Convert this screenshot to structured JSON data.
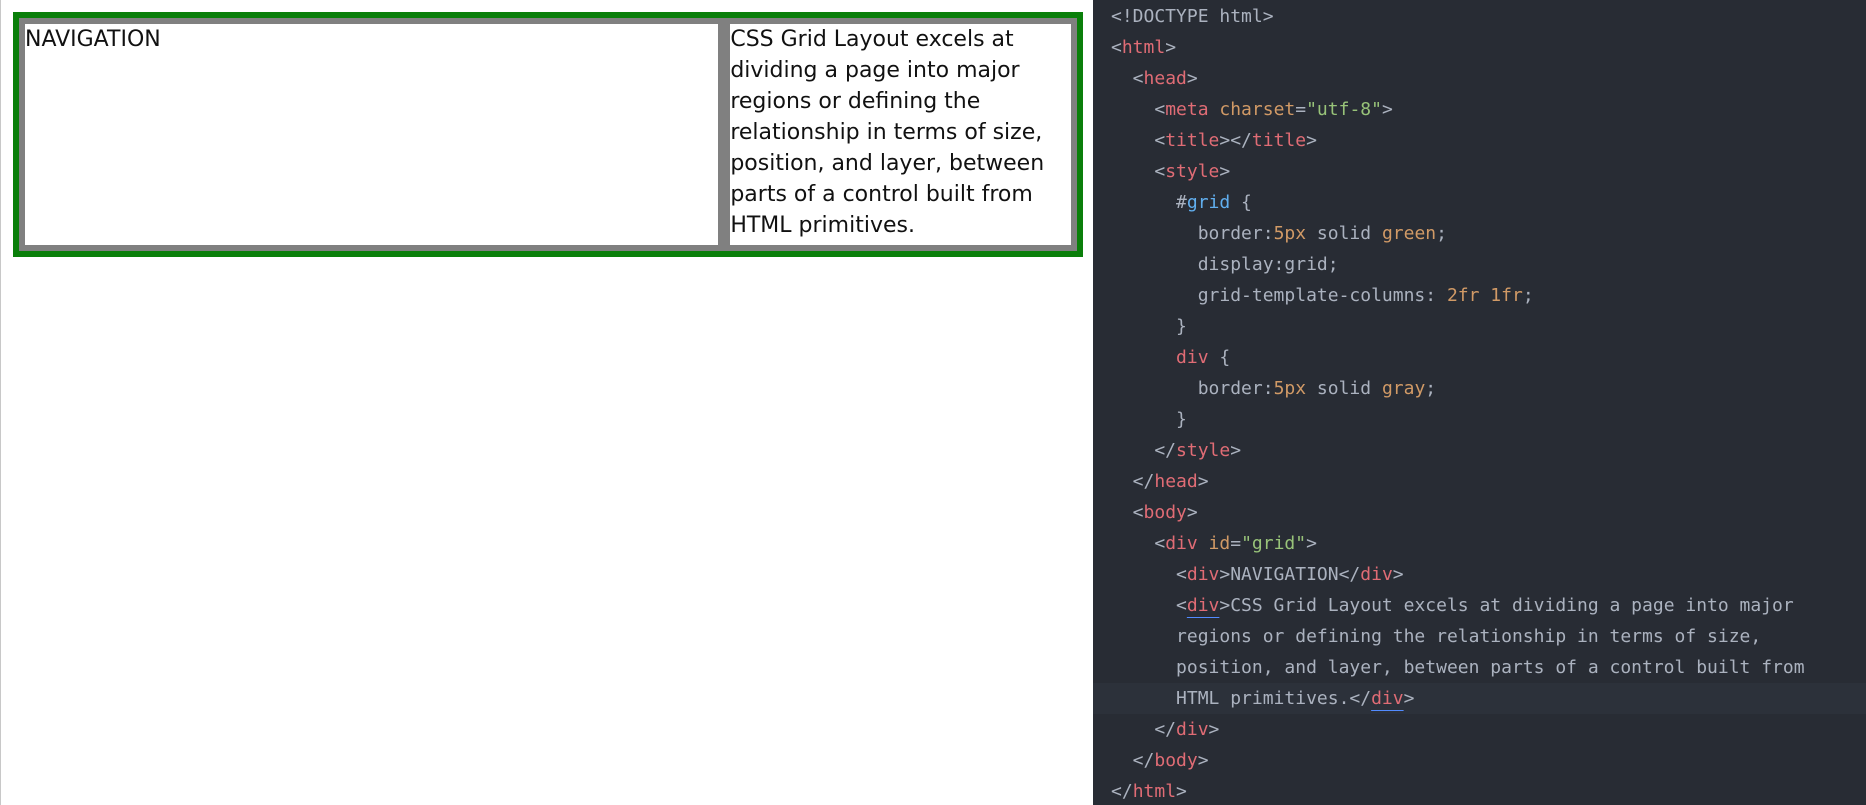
{
  "preview": {
    "nav_text": "NAVIGATION",
    "main_text": "CSS Grid Layout excels at\ndividing a page into major\nregions or defining the\nrelationship in terms of size,\nposition, and layer, between\nparts of a control built from\nHTML primitives."
  },
  "code": {
    "lines": [
      [
        {
          "t": "<!DOCTYPE html>",
          "c": "plain"
        }
      ],
      [
        {
          "t": "<",
          "c": "plain"
        },
        {
          "t": "html",
          "c": "tag"
        },
        {
          "t": ">",
          "c": "plain"
        }
      ],
      [
        {
          "t": "  <",
          "c": "plain"
        },
        {
          "t": "head",
          "c": "tag"
        },
        {
          "t": ">",
          "c": "plain"
        }
      ],
      [
        {
          "t": "    <",
          "c": "plain"
        },
        {
          "t": "meta",
          "c": "tag"
        },
        {
          "t": " charset",
          "c": "attr"
        },
        {
          "t": "=",
          "c": "plain"
        },
        {
          "t": "\"utf-8\"",
          "c": "str"
        },
        {
          "t": ">",
          "c": "plain"
        }
      ],
      [
        {
          "t": "    <",
          "c": "plain"
        },
        {
          "t": "title",
          "c": "tag"
        },
        {
          "t": "></",
          "c": "plain"
        },
        {
          "t": "title",
          "c": "tag"
        },
        {
          "t": ">",
          "c": "plain"
        }
      ],
      [
        {
          "t": "    <",
          "c": "plain"
        },
        {
          "t": "style",
          "c": "tag"
        },
        {
          "t": ">",
          "c": "plain"
        }
      ],
      [
        {
          "t": "      #",
          "c": "plain"
        },
        {
          "t": "grid",
          "c": "id"
        },
        {
          "t": " {",
          "c": "plain"
        }
      ],
      [
        {
          "t": "        border:",
          "c": "plain"
        },
        {
          "t": "5px",
          "c": "num"
        },
        {
          "t": " solid ",
          "c": "plain"
        },
        {
          "t": "green",
          "c": "num"
        },
        {
          "t": ";",
          "c": "plain"
        }
      ],
      [
        {
          "t": "        display:grid;",
          "c": "plain"
        }
      ],
      [
        {
          "t": "        grid-template-columns: ",
          "c": "plain"
        },
        {
          "t": "2fr 1fr",
          "c": "num"
        },
        {
          "t": ";",
          "c": "plain"
        }
      ],
      [
        {
          "t": "      }",
          "c": "plain"
        }
      ],
      [
        {
          "t": "      ",
          "c": "plain"
        },
        {
          "t": "div",
          "c": "tag"
        },
        {
          "t": " {",
          "c": "plain"
        }
      ],
      [
        {
          "t": "        border:",
          "c": "plain"
        },
        {
          "t": "5px",
          "c": "num"
        },
        {
          "t": " solid ",
          "c": "plain"
        },
        {
          "t": "gray",
          "c": "num"
        },
        {
          "t": ";",
          "c": "plain"
        }
      ],
      [
        {
          "t": "      }",
          "c": "plain"
        }
      ],
      [
        {
          "t": "    </",
          "c": "plain"
        },
        {
          "t": "style",
          "c": "tag"
        },
        {
          "t": ">",
          "c": "plain"
        }
      ],
      [
        {
          "t": "  </",
          "c": "plain"
        },
        {
          "t": "head",
          "c": "tag"
        },
        {
          "t": ">",
          "c": "plain"
        }
      ],
      [
        {
          "t": "  <",
          "c": "plain"
        },
        {
          "t": "body",
          "c": "tag"
        },
        {
          "t": ">",
          "c": "plain"
        }
      ],
      [
        {
          "t": "    <",
          "c": "plain"
        },
        {
          "t": "div",
          "c": "tag"
        },
        {
          "t": " id",
          "c": "attr"
        },
        {
          "t": "=",
          "c": "plain"
        },
        {
          "t": "\"grid\"",
          "c": "str"
        },
        {
          "t": ">",
          "c": "plain"
        }
      ],
      [
        {
          "t": "      <",
          "c": "plain"
        },
        {
          "t": "div",
          "c": "tag"
        },
        {
          "t": ">NAVIGATION</",
          "c": "plain"
        },
        {
          "t": "div",
          "c": "tag"
        },
        {
          "t": ">",
          "c": "plain"
        }
      ],
      [
        {
          "t": "      <",
          "c": "plain"
        },
        {
          "t": "div",
          "c": "tag",
          "u": true
        },
        {
          "t": ">CSS Grid Layout excels at dividing a page into major",
          "c": "plain"
        }
      ],
      [
        {
          "t": "      regions or defining the relationship in terms of size,",
          "c": "plain"
        }
      ],
      [
        {
          "t": "      position, and layer, between parts of a control built from",
          "c": "plain"
        }
      ],
      [
        {
          "t": "      HTML primitives.</",
          "c": "plain"
        },
        {
          "t": "div",
          "c": "tag",
          "u": true
        },
        {
          "t": ">",
          "c": "plain"
        }
      ],
      [
        {
          "t": "    </",
          "c": "plain"
        },
        {
          "t": "div",
          "c": "tag"
        },
        {
          "t": ">",
          "c": "plain"
        }
      ],
      [
        {
          "t": "  </",
          "c": "plain"
        },
        {
          "t": "body",
          "c": "tag"
        },
        {
          "t": ">",
          "c": "plain"
        }
      ],
      [
        {
          "t": "</",
          "c": "plain"
        },
        {
          "t": "html",
          "c": "tag"
        },
        {
          "t": ">",
          "c": "plain"
        }
      ]
    ],
    "active_line": 22
  },
  "colors": {
    "grid_border": "#0a7f0a",
    "cell_border": "#808080",
    "editor_bg": "#282c34"
  }
}
